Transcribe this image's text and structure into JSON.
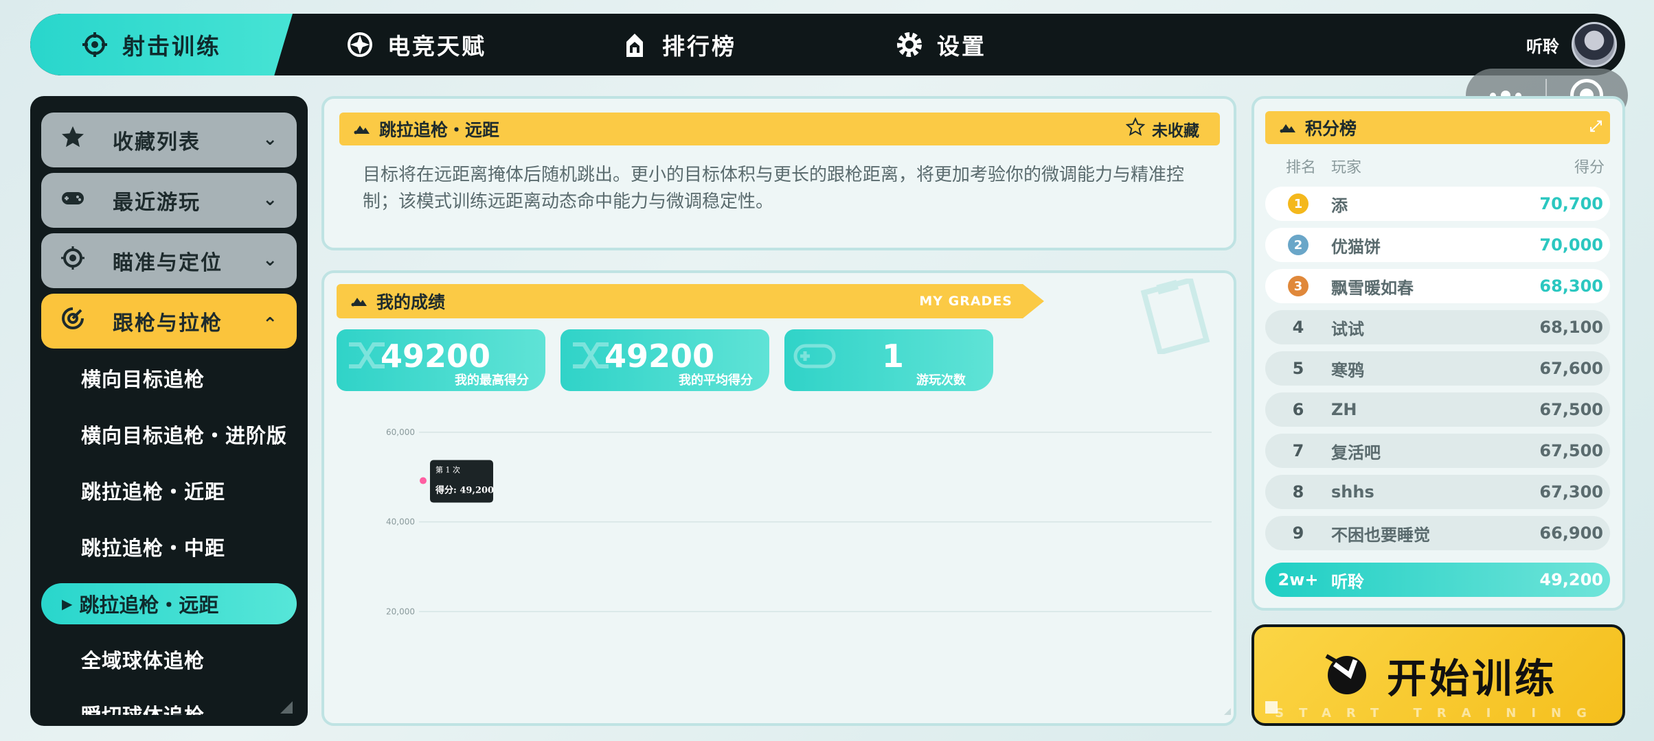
{
  "nav": {
    "items": [
      {
        "label": "射击训练",
        "icon": "crosshair-icon"
      },
      {
        "label": "电竞天赋",
        "icon": "compass-icon"
      },
      {
        "label": "排行榜",
        "icon": "trophy-icon"
      },
      {
        "label": "设置",
        "icon": "gear-icon"
      }
    ],
    "username": "听聆"
  },
  "sidebar": {
    "categories": [
      {
        "label": "收藏列表",
        "icon": "star-icon"
      },
      {
        "label": "最近游玩",
        "icon": "gamepad-icon"
      },
      {
        "label": "瞄准与定位",
        "icon": "aim-icon"
      },
      {
        "label": "跟枪与拉枪",
        "icon": "tracking-icon"
      }
    ],
    "items": [
      "横向目标追枪",
      "横向目标追枪・进阶版",
      "跳拉追枪・近距",
      "跳拉追枪・中距",
      "跳拉追枪・远距",
      "全域球体追枪",
      "瞬切球体追枪"
    ],
    "selected_index": 4
  },
  "mode": {
    "title": "跳拉追枪・远距",
    "favorite_label": "未收藏",
    "description": "目标将在远距离掩体后随机跳出。更小的目标体积与更长的跟枪距离，将更加考验你的微调能力与精准控制；该模式训练远距离动态命中能力与微调稳定性。"
  },
  "grades": {
    "title": "我的成绩",
    "title_en": "MY GRADES",
    "stats": [
      {
        "value": "49200",
        "label": "我的最高得分"
      },
      {
        "value": "49200",
        "label": "我的平均得分"
      },
      {
        "value": "1",
        "label": "游玩次数"
      }
    ],
    "tooltip": {
      "title": "第 1 次",
      "text": "得分: 49,200"
    }
  },
  "chart_data": {
    "type": "line",
    "x": [
      1
    ],
    "series": [
      {
        "values": [
          49200
        ]
      }
    ],
    "y_ticks": [
      "60,000",
      "40,000",
      "20,000"
    ],
    "ylim": [
      0,
      60000
    ],
    "grid": true
  },
  "leaderboard": {
    "title": "积分榜",
    "headers": {
      "rank": "排名",
      "player": "玩家",
      "score": "得分"
    },
    "rows": [
      {
        "rank": "1",
        "name": "添",
        "score": "70,700"
      },
      {
        "rank": "2",
        "name": "优猫饼",
        "score": "70,000"
      },
      {
        "rank": "3",
        "name": "飘雪暖如春",
        "score": "68,300"
      },
      {
        "rank": "4",
        "name": "试试",
        "score": "68,100"
      },
      {
        "rank": "5",
        "name": "寒鸦",
        "score": "67,600"
      },
      {
        "rank": "6",
        "name": "ZH",
        "score": "67,500"
      },
      {
        "rank": "7",
        "name": "复活吧",
        "score": "67,500"
      },
      {
        "rank": "8",
        "name": "shhs",
        "score": "67,300"
      },
      {
        "rank": "9",
        "name": "不困也要睡觉",
        "score": "66,900"
      }
    ],
    "me": {
      "rank": "2w+",
      "name": "听聆",
      "score": "49,200"
    },
    "colors": {
      "gold": "#f4b81c",
      "silver": "#6aa6c8",
      "bronze": "#e0883a",
      "accent": "#2bc7c0"
    }
  },
  "start_button": {
    "label": "开始训练",
    "label_en": "START TRAINING"
  }
}
